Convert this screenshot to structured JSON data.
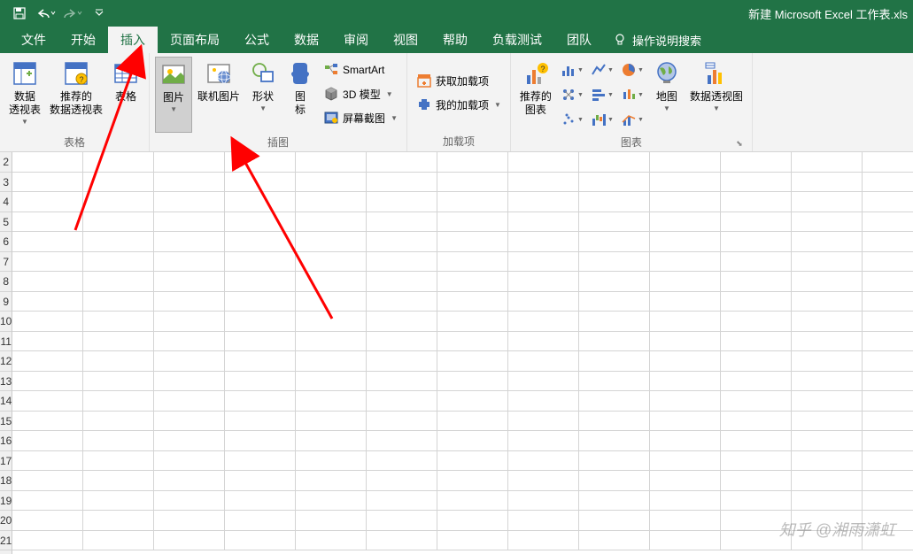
{
  "title": "新建 Microsoft Excel 工作表.xls",
  "tabs": [
    "文件",
    "开始",
    "插入",
    "页面布局",
    "公式",
    "数据",
    "审阅",
    "视图",
    "帮助",
    "负载测试",
    "团队"
  ],
  "active_tab_index": 2,
  "tell_me": "操作说明搜索",
  "ribbon": {
    "tables": {
      "label": "表格",
      "pivot_table": "数据\n透视表",
      "recommended_pivot": "推荐的\n数据透视表",
      "table": "表格"
    },
    "illustrations": {
      "label": "插图",
      "pictures": "图片",
      "online_pictures": "联机图片",
      "shapes": "形状",
      "icons": "图\n标",
      "smartart": "SmartArt",
      "3d_models": "3D 模型",
      "screenshot": "屏幕截图"
    },
    "addins": {
      "label": "加载项",
      "get_addins": "获取加载项",
      "my_addins": "我的加载项"
    },
    "charts": {
      "label": "图表",
      "recommended": "推荐的\n图表",
      "maps": "地图",
      "pivot_chart": "数据透视图"
    }
  },
  "row_numbers": [
    2,
    3,
    4,
    5,
    6,
    7,
    8,
    9,
    10,
    11,
    12,
    13,
    14,
    15,
    16,
    17,
    18,
    19,
    20,
    21
  ],
  "watermark": "知乎 @湘雨潇虹"
}
